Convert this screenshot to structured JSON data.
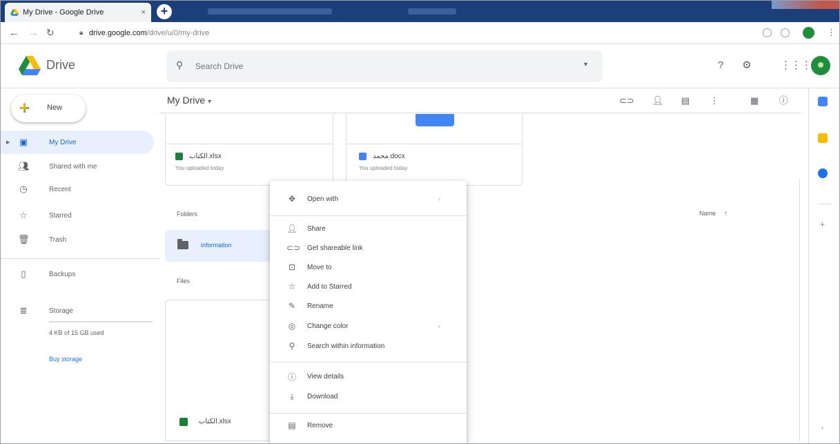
{
  "browser": {
    "tab_title": "My Drive - Google Drive",
    "tab_close": "×",
    "new_tab": "+",
    "url_host": "drive.google.com",
    "url_path": "/drive/u/0/my-drive"
  },
  "header": {
    "app_name": "Drive",
    "search_placeholder": "Search Drive"
  },
  "sidebar": {
    "new_label": "New",
    "items": [
      {
        "label": "My Drive",
        "icon": "my-drive-icon"
      },
      {
        "label": "Shared with me",
        "icon": "shared-icon"
      },
      {
        "label": "Recent",
        "icon": "clock-icon"
      },
      {
        "label": "Starred",
        "icon": "star-icon"
      },
      {
        "label": "Trash",
        "icon": "trash-icon"
      },
      {
        "label": "Backups",
        "icon": "backups-icon"
      },
      {
        "label": "Storage",
        "icon": "storage-icon"
      }
    ],
    "storage_used": "4 KB of 15 GB used",
    "buy_storage": "Buy storage"
  },
  "toolbar": {
    "title": "My Drive"
  },
  "main": {
    "quick_access": [
      {
        "name": "الكتاب.xlsx",
        "type": "sheet",
        "sub": "You uploaded today"
      },
      {
        "name": "محمد.docx",
        "type": "doc",
        "sub": "You uploaded today"
      }
    ],
    "folders_label": "Folders",
    "sort_label": "Name",
    "sort_arrow": "↑",
    "folders": [
      {
        "name": "information"
      }
    ],
    "files_label": "Files",
    "files": [
      {
        "name": "الكتاب.xlsx",
        "type": "sheet"
      }
    ]
  },
  "context_menu": {
    "items": [
      {
        "label": "Open with",
        "icon": "open-with-icon",
        "submenu": true
      },
      {
        "label": "Share",
        "icon": "share-icon"
      },
      {
        "label": "Get shareable link",
        "icon": "link-icon"
      },
      {
        "label": "Move to",
        "icon": "move-to-icon"
      },
      {
        "label": "Add to Starred",
        "icon": "star-icon"
      },
      {
        "label": "Rename",
        "icon": "rename-icon"
      },
      {
        "label": "Change color",
        "icon": "palette-icon",
        "submenu": true
      },
      {
        "label": "Search within information",
        "icon": "search-icon"
      },
      {
        "label": "View details",
        "icon": "info-icon"
      },
      {
        "label": "Download",
        "icon": "download-icon"
      },
      {
        "label": "Remove",
        "icon": "trash-icon"
      }
    ]
  },
  "colors": {
    "accent": "#1a73e8",
    "selected_bg": "#e8f0fe",
    "sheets_green": "#188038",
    "docs_blue": "#4285f4"
  }
}
